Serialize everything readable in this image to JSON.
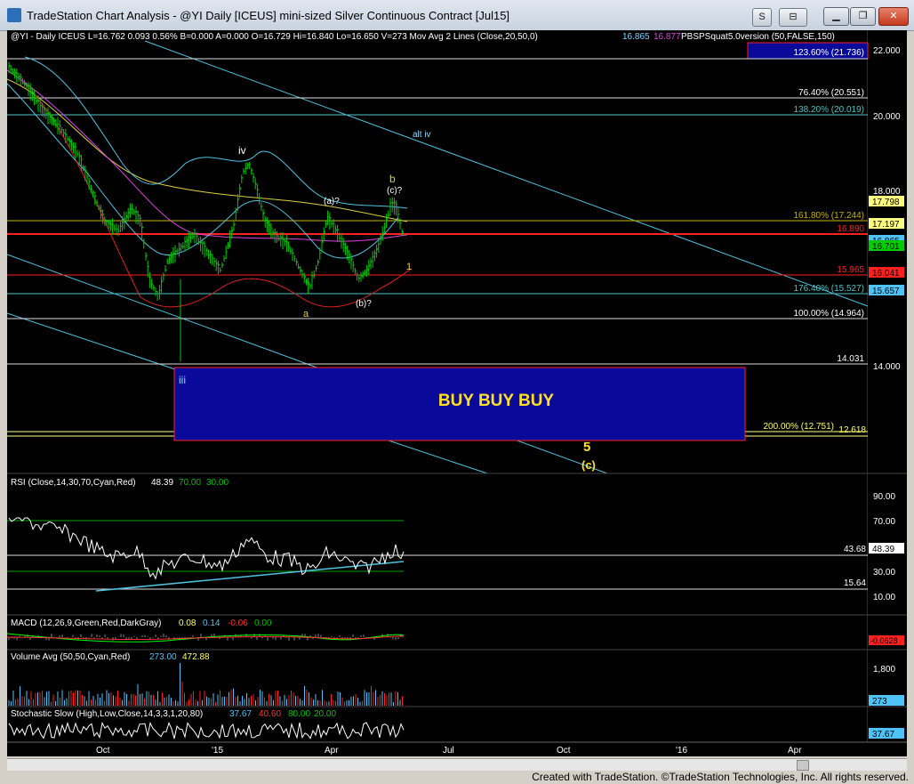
{
  "window": {
    "title": "TradeStation Chart Analysis - @YI Daily [ICEUS] mini-sized Silver Continuous Contract [Jul15]",
    "buttons": [
      "S",
      "⊟"
    ],
    "controls": [
      "minimize",
      "restore",
      "close"
    ]
  },
  "status_line": {
    "segments": [
      {
        "text": "@YI - Daily  ICEUS  L=16.762  0.093  0.56%  B=0.000  A=0.000  O=16.729  Hi=16.840  Lo=16.650  V=273  Mov Avg 2 Lines (Close,20,50,0)",
        "color": "#ffffff"
      },
      {
        "text": "16.865",
        "color": "#7fd3ff"
      },
      {
        "text": "16.877",
        "color": "#e040e0"
      },
      {
        "text": "PBSPSquat5.0version (50,FALSE,150)",
        "color": "#ffffff"
      }
    ]
  },
  "price_axis": {
    "ticks": [
      "22.000",
      "20.000",
      "18.000",
      "14.000"
    ],
    "price_tags": [
      {
        "label": "17.798",
        "bg": "#ffff80",
        "fg": "#000000"
      },
      {
        "label": "17.197",
        "bg": "#ffff80",
        "fg": "#000000"
      },
      {
        "label": "16.865",
        "bg": "#4fc3f7",
        "fg": "#000000"
      },
      {
        "label": "16.701",
        "bg": "#00cc00",
        "fg": "#000000"
      },
      {
        "label": "16.041",
        "bg": "#ff2020",
        "fg": "#000000"
      },
      {
        "label": "15.657",
        "bg": "#4fc3f7",
        "fg": "#000000"
      }
    ]
  },
  "levels": [
    {
      "label": "123.60% (21.736)",
      "color": "#ffffff"
    },
    {
      "label": "76.40% (20.551)",
      "color": "#ffffff"
    },
    {
      "label": "138.20% (20.019)",
      "color": "#4fc3c3"
    },
    {
      "label": "161.80% (17.244)",
      "color": "#c8b400"
    },
    {
      "label": "16.890",
      "color": "#ff2020"
    },
    {
      "label": "15.965",
      "color": "#ff2020"
    },
    {
      "label": "176.40% (15.527)",
      "color": "#4fc3c3"
    },
    {
      "label": "100.00% (14.964)",
      "color": "#ffffff"
    },
    {
      "label": "14.031",
      "color": "#ffffff"
    },
    {
      "label": "200.00% (12.751)",
      "color": "#ffff60"
    },
    {
      "label": "12.618",
      "color": "#ffff60"
    }
  ],
  "wave_labels": {
    "alt_iv": "alt iv",
    "iv": "iv",
    "b": "b",
    "c_q": "(c)?",
    "a_q": "(a)?",
    "one": "1",
    "a": "a",
    "b_q": "(b)?",
    "iii": "iii",
    "five": "5",
    "c": "(c)"
  },
  "buy_box": {
    "label": "BUY BUY BUY"
  },
  "rsi": {
    "header": [
      {
        "text": "RSI (Close,14,30,70,Cyan,Red)",
        "color": "#ffffff"
      },
      {
        "text": "48.39",
        "color": "#ffffff"
      },
      {
        "text": "70.00",
        "color": "#00c000"
      },
      {
        "text": "30.00",
        "color": "#00c000"
      }
    ],
    "ticks": [
      "90.00",
      "70.00",
      "30.00",
      "10.00"
    ],
    "levels": [
      "43.68",
      "15.64"
    ],
    "last": "48.39"
  },
  "macd": {
    "header": [
      {
        "text": "MACD (12,26,9,Green,Red,DarkGray)",
        "color": "#ffffff"
      },
      {
        "text": "0.08",
        "color": "#ffff60"
      },
      {
        "text": "0.14",
        "color": "#4fc3f7"
      },
      {
        "text": "-0.06",
        "color": "#ff3030"
      },
      {
        "text": "0.00",
        "color": "#00c000"
      }
    ],
    "last": "-0.0628"
  },
  "volume": {
    "header": [
      {
        "text": "Volume Avg (50,50,Cyan,Red)",
        "color": "#ffffff"
      },
      {
        "text": "273.00",
        "color": "#4fc3f7"
      },
      {
        "text": "472.88",
        "color": "#ffff60"
      }
    ],
    "ticks": [
      "1,800"
    ],
    "last": "273"
  },
  "stochastic": {
    "header": [
      {
        "text": "Stochastic Slow (High,Low,Close,14,3,3,1,20,80)",
        "color": "#ffffff"
      },
      {
        "text": "37.67",
        "color": "#4fc3f7"
      },
      {
        "text": "40.60",
        "color": "#ff3030"
      },
      {
        "text": "80.00",
        "color": "#00c000"
      },
      {
        "text": "20.00",
        "color": "#00c000"
      }
    ],
    "last": "37.67"
  },
  "time_axis": [
    "Oct",
    "'15",
    "Apr",
    "Jul",
    "Oct",
    "'16",
    "Apr"
  ],
  "footer": "Created with TradeStation. ©TradeStation Technologies, Inc. All rights reserved.",
  "colors": {
    "background": "#000000",
    "price_bars": "#00cc00",
    "channel": "#4fc3e0",
    "buy_box_fill": "#0a0a9a",
    "buy_box_border": "#ff2020",
    "buy_box_text": "#ffe020"
  }
}
